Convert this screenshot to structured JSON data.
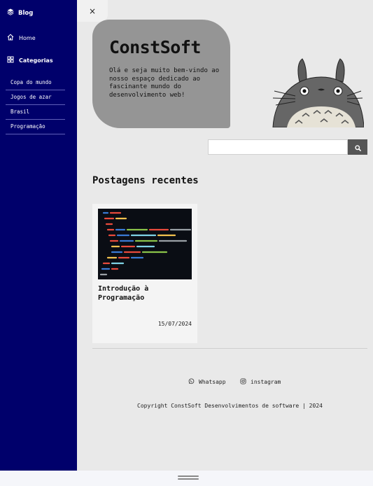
{
  "sidebar": {
    "brand": "Blog",
    "home_label": "Home",
    "categories_label": "Categorias",
    "categories": [
      "Copa do mundo",
      "Jogos de azar",
      "Brasil",
      "Programação"
    ]
  },
  "close_label": "×",
  "hero": {
    "title": "ConstSoft",
    "description": "Olá e seja muito bem-vindo ao nosso espaço dedicado ao fascinante mundo do desenvolvimento web!"
  },
  "search": {
    "placeholder": "",
    "value": ""
  },
  "recent_posts": {
    "heading": "Postagens recentes",
    "posts": [
      {
        "title": "Introdução à Programação",
        "date": "15/07/2024"
      }
    ]
  },
  "footer": {
    "whatsapp_label": "Whatsapp",
    "instagram_label": "instagram",
    "copyright": "Copyright ConstSoft Desenvolvimentos de software | 2024"
  },
  "colors": {
    "sidebar_bg": "#00006b",
    "page_bg": "#e9e9e9",
    "hero_bg": "#959595",
    "search_button": "#555555"
  },
  "icons": {
    "brand": "cube-icon",
    "home": "house-icon",
    "categories": "grid-icon",
    "search": "magnifier-icon",
    "whatsapp": "whatsapp-icon",
    "instagram": "instagram-icon"
  }
}
